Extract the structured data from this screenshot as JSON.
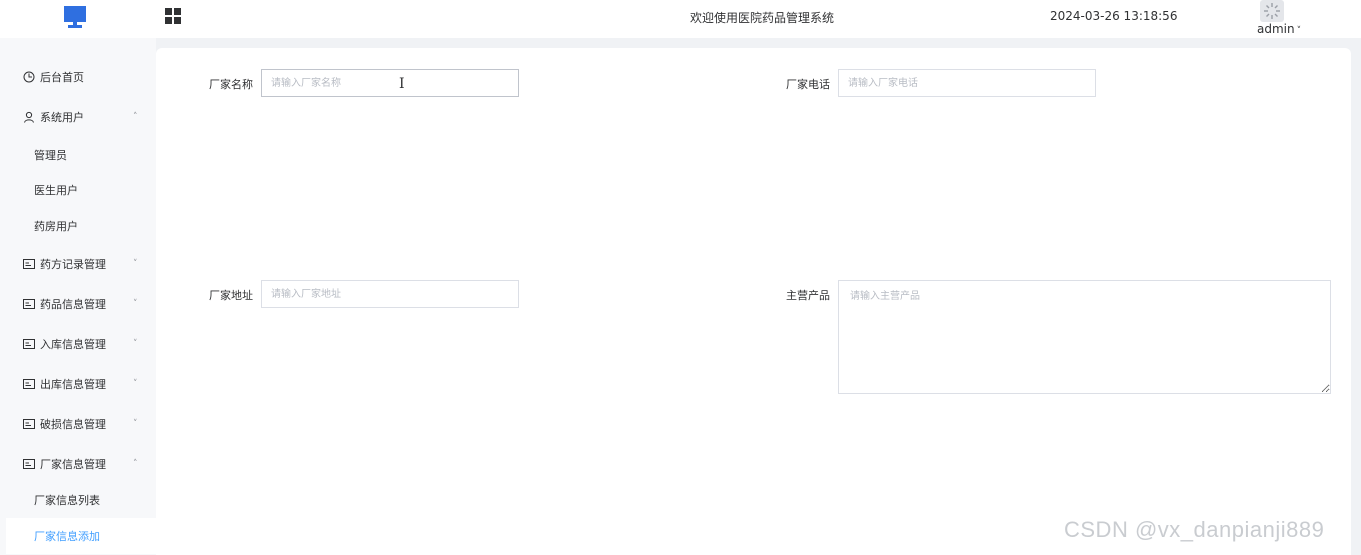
{
  "header": {
    "welcome": "欢迎使用医院药品管理系统",
    "datetime": "2024-03-26 13:18:56",
    "user": "admin",
    "icons": [
      "monitor-logo-icon",
      "apps-grid-icon",
      "user-avatar-icon"
    ],
    "colors": {
      "logo": "#2f6fe0"
    }
  },
  "sidebar": {
    "items": [
      {
        "label": "后台首页",
        "icon": "clock-icon"
      },
      {
        "label": "系统用户",
        "icon": "user-icon",
        "expanded": true
      },
      {
        "label": "管理员"
      },
      {
        "label": "医生用户"
      },
      {
        "label": "药房用户"
      },
      {
        "label": "药方记录管理",
        "icon": "card-icon"
      },
      {
        "label": "药品信息管理",
        "icon": "card-icon"
      },
      {
        "label": "入库信息管理",
        "icon": "card-icon"
      },
      {
        "label": "出库信息管理",
        "icon": "card-icon"
      },
      {
        "label": "破损信息管理",
        "icon": "card-icon"
      },
      {
        "label": "厂家信息管理",
        "icon": "card-icon",
        "expanded": true
      },
      {
        "label": "厂家信息列表"
      },
      {
        "label": "厂家信息添加",
        "active": true
      }
    ],
    "active_color": "#409eff"
  },
  "form": {
    "name_label": "厂家名称",
    "name_placeholder": "请输入厂家名称",
    "phone_label": "厂家电话",
    "phone_placeholder": "请输入厂家电话",
    "address_label": "厂家地址",
    "address_placeholder": "请输入厂家地址",
    "product_label": "主营产品",
    "product_placeholder": "请输入主营产品"
  },
  "watermark": "CSDN @vx_danpianji889"
}
